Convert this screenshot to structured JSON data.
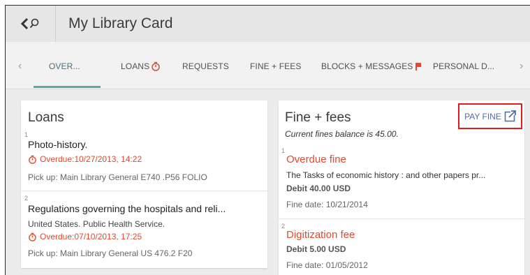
{
  "header": {
    "title": "My Library Card",
    "back_icon": "chevron-left-icon",
    "search_icon": "search-icon"
  },
  "tabs": [
    {
      "label": "OVER..."
    },
    {
      "label": "LOANS"
    },
    {
      "label": "REQUESTS"
    },
    {
      "label": "FINE + FEES"
    },
    {
      "label": "BLOCKS + MESSAGES"
    },
    {
      "label": "PERSONAL D..."
    }
  ],
  "loans": {
    "title": "Loans",
    "items": [
      {
        "num": "1",
        "title": "Photo-history.",
        "overdue": "Overdue:10/27/2013, 14:22",
        "pickup": "Pick up: Main Library General E740 .P56 FOLIO"
      },
      {
        "num": "2",
        "title": "Regulations governing the hospitals and reli...",
        "author": "United States. Public Health Service.",
        "overdue": "Overdue:07/10/2013, 17:25",
        "pickup": "Pick up: Main Library General US 476.2 F20"
      }
    ]
  },
  "fines": {
    "title": "Fine + fees",
    "balance": "Current fines balance is 45.00.",
    "pay_label": "PAY FINE",
    "items": [
      {
        "num": "1",
        "title": "Overdue fine",
        "desc": "The Tasks of economic history : and other papers pr...",
        "debit": "Debit 40.00 USD",
        "date": "Fine date: 10/21/2014"
      },
      {
        "num": "2",
        "title": "Digitization fee",
        "debit": "Debit 5.00 USD",
        "date": "Fine date: 01/05/2012"
      }
    ]
  },
  "colors": {
    "accent": "#5aa7a8",
    "overdue": "#e04a2f",
    "link": "#4f6fa8",
    "highlight_box": "#e21b1b"
  }
}
